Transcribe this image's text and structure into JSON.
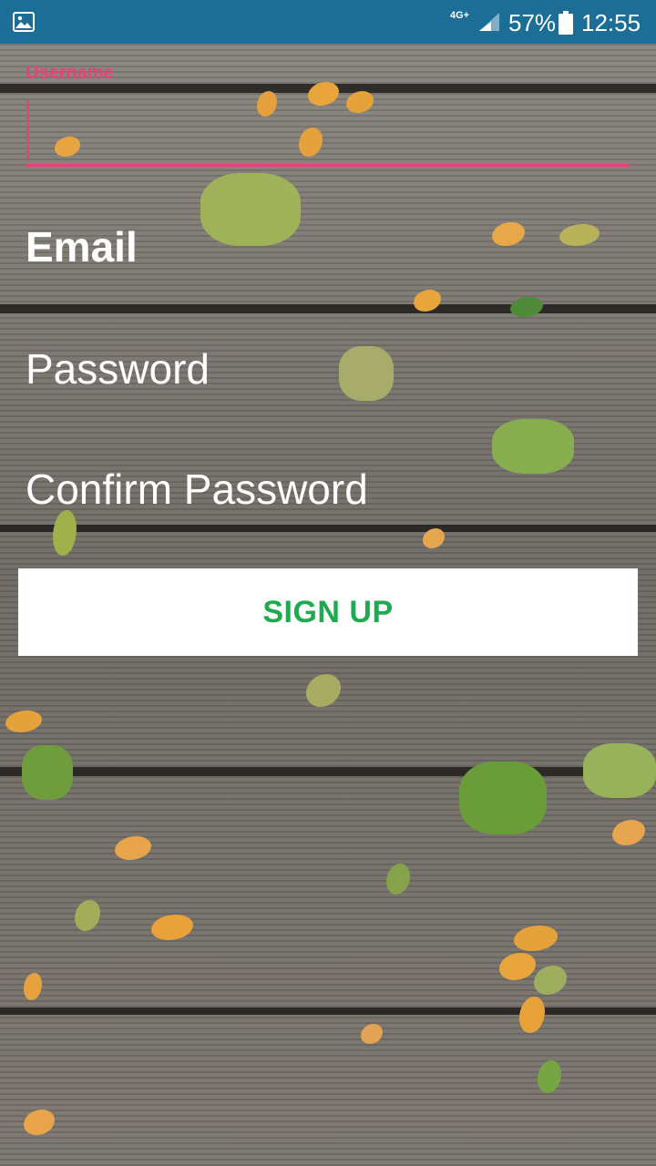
{
  "status_bar": {
    "network": "4G+",
    "battery_percent": "57%",
    "time": "12:55",
    "left_icon": "image-icon"
  },
  "form": {
    "username_label": "Username",
    "email_placeholder": "Email",
    "password_placeholder": "Password",
    "confirm_password_placeholder": "Confirm Password",
    "accent_color": "#e9407a"
  },
  "signup_button": {
    "label": "SIGN UP",
    "text_color": "#1faa4f"
  }
}
